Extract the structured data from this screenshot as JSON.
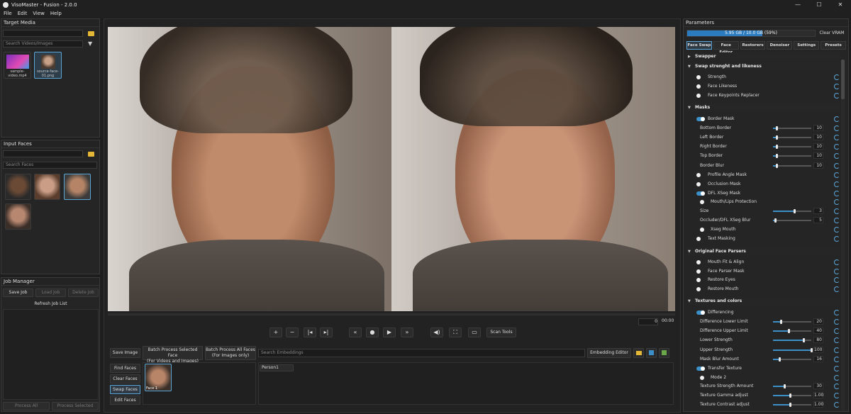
{
  "window": {
    "title": "VisoMaster - Fusion - 2.0.0"
  },
  "menu": [
    "File",
    "Edit",
    "View",
    "Help"
  ],
  "target_media": {
    "title": "Target Media",
    "search_placeholder": "Search Videos/Images",
    "items": [
      {
        "label": "sample-video.mp4"
      },
      {
        "label": "source-face-01.png"
      }
    ]
  },
  "input_faces": {
    "title": "Input Faces",
    "search_placeholder": "Search Faces"
  },
  "job_manager": {
    "title": "Job Manager",
    "save": "Save Job",
    "load": "Load Job",
    "delete": "Delete Job",
    "refresh": "Refresh Job List",
    "process_all": "Process All",
    "process_selected": "Process Selected"
  },
  "playback": {
    "frame": "0",
    "time": "00:00",
    "scan_tools": "Scan Tools"
  },
  "bottom": {
    "save_image": "Save Image",
    "batch_selected": "Batch Process Selected Face",
    "batch_selected_sub": "(For Videos and Images)",
    "batch_all": "Batch Process All Faces",
    "batch_all_sub": "(For Images only)",
    "search_embeddings": "Search Embeddings",
    "embedding_editor": "Embedding Editor",
    "find_faces": "Find Faces",
    "clear_faces": "Clear Faces",
    "swap_faces": "Swap Faces",
    "edit_faces": "Edit Faces",
    "face_label": "Face 1",
    "person": "Person1"
  },
  "parameters": {
    "title": "Parameters",
    "vram_text": "5.95 GB / 10.0 GB (59%)",
    "vram_fraction": 0.59,
    "clear_vram": "Clear VRAM",
    "tabs": [
      "Face Swap",
      "Face Editor",
      "Restorers",
      "Denoiser",
      "Settings",
      "Presets"
    ],
    "rows": [
      {
        "kind": "section",
        "label": "Swapper",
        "collapsed": true
      },
      {
        "kind": "section",
        "label": "Swap strenght and likeness"
      },
      {
        "kind": "radio",
        "label": "Strength"
      },
      {
        "kind": "radio",
        "label": "Face Likeness"
      },
      {
        "kind": "radio",
        "label": "Face Keypoints Replacer"
      },
      {
        "kind": "section",
        "label": "Masks"
      },
      {
        "kind": "toggle",
        "label": "Border Mask"
      },
      {
        "kind": "slider",
        "label": "Bottom Border",
        "value": "10",
        "level": 0.1
      },
      {
        "kind": "slider",
        "label": "Left Border",
        "value": "10",
        "level": 0.1
      },
      {
        "kind": "slider",
        "label": "Right Border",
        "value": "10",
        "level": 0.1
      },
      {
        "kind": "slider",
        "label": "Top Border",
        "value": "10",
        "level": 0.1
      },
      {
        "kind": "slider",
        "label": "Border Blur",
        "value": "10",
        "level": 0.1
      },
      {
        "kind": "radio",
        "label": "Profile Angle Mask"
      },
      {
        "kind": "radio",
        "label": "Occlusion Mask"
      },
      {
        "kind": "toggle",
        "label": "DFL XSeg Mask"
      },
      {
        "kind": "radio2",
        "label": "Mouth/Lips Protection"
      },
      {
        "kind": "slider0",
        "label": "Size",
        "value": "3",
        "level": 0.55
      },
      {
        "kind": "slider0",
        "label": "Occluder/DFL XSeg Blur",
        "value": "5",
        "level": 0.05
      },
      {
        "kind": "radio2",
        "label": "Xseg Mouth"
      },
      {
        "kind": "radio",
        "label": "Text Masking"
      },
      {
        "kind": "section",
        "label": "Original Face Parsers"
      },
      {
        "kind": "radio",
        "label": "Mouth Fit & Align"
      },
      {
        "kind": "radio",
        "label": "Face Parser Mask"
      },
      {
        "kind": "radio",
        "label": "Restore Eyes"
      },
      {
        "kind": "radio",
        "label": "Restore Mouth"
      },
      {
        "kind": "section",
        "label": "Textures and colors"
      },
      {
        "kind": "toggle",
        "label": "Differencing"
      },
      {
        "kind": "slider",
        "label": "Difference Lower Limit",
        "value": "20",
        "level": 0.2
      },
      {
        "kind": "slider",
        "label": "Difference Upper Limit",
        "value": "40",
        "level": 0.4
      },
      {
        "kind": "slider",
        "label": "Lower Strength",
        "value": "80",
        "level": 0.8
      },
      {
        "kind": "slider",
        "label": "Upper Strength",
        "value": "100",
        "level": 1.0
      },
      {
        "kind": "slider",
        "label": "Mask Blur Amount",
        "value": "16",
        "level": 0.16
      },
      {
        "kind": "toggle",
        "label": "Transfer Texture"
      },
      {
        "kind": "radio2",
        "label": "Mode 2"
      },
      {
        "kind": "slider",
        "label": "Texture Strength Amount",
        "value": "30",
        "level": 0.3
      },
      {
        "kind": "slider",
        "label": "Texture Gamma adjust",
        "value": "1.00",
        "level": 0.45
      },
      {
        "kind": "slider",
        "label": "Texture Contrast adjust",
        "value": "1.00",
        "level": 0.45
      }
    ]
  }
}
